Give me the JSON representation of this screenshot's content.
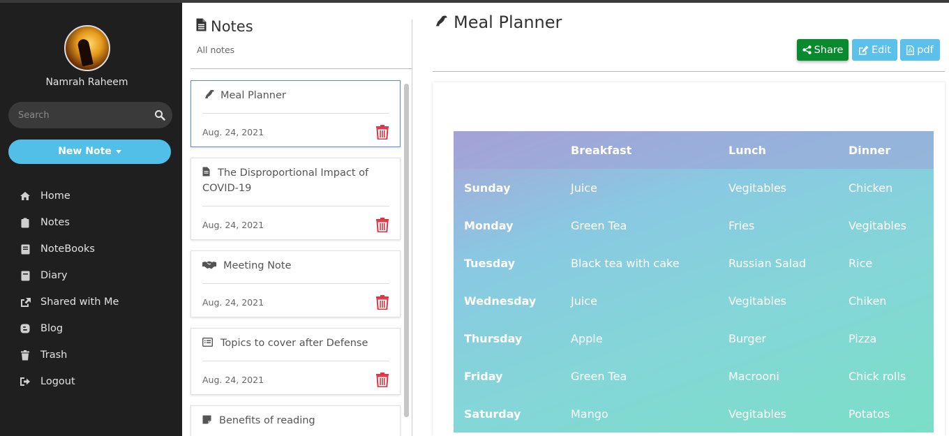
{
  "sidebar": {
    "username": "Namrah Raheem",
    "search_placeholder": "Search",
    "new_note_label": "New Note",
    "nav": [
      {
        "label": "Home",
        "icon": "home-icon"
      },
      {
        "label": "Notes",
        "icon": "clipboard-icon"
      },
      {
        "label": "NoteBooks",
        "icon": "book-icon"
      },
      {
        "label": "Diary",
        "icon": "diary-icon"
      },
      {
        "label": "Shared with Me",
        "icon": "share-square-icon"
      },
      {
        "label": "Blog",
        "icon": "blogger-icon"
      },
      {
        "label": "Trash",
        "icon": "trash-icon"
      },
      {
        "label": "Logout",
        "icon": "logout-icon"
      }
    ]
  },
  "notes": {
    "title": "Notes",
    "subtitle": "All notes",
    "items": [
      {
        "title": "Meal Planner",
        "date": "Aug. 24, 2021",
        "icon": "dinosaur-icon",
        "active": true
      },
      {
        "title": "The Disproportional Impact of COVID-19",
        "date": "Aug. 24, 2021",
        "icon": "file-icon"
      },
      {
        "title": "Meeting Note",
        "date": "Aug. 24, 2021",
        "icon": "handshake-icon"
      },
      {
        "title": "Topics to cover after Defense",
        "date": "Aug. 24, 2021",
        "icon": "list-alt-icon"
      },
      {
        "title": "Benefits of reading",
        "date": "",
        "icon": "sticky-note-icon"
      }
    ]
  },
  "content": {
    "title": "Meal Planner",
    "buttons": {
      "share": "Share",
      "edit": "Edit",
      "pdf": "pdf"
    },
    "table": {
      "headers": [
        "",
        "Breakfast",
        "Lunch",
        "Dinner"
      ],
      "rows": [
        [
          "Sunday",
          "Juice",
          "Vegitables",
          "Chicken"
        ],
        [
          "Monday",
          "Green Tea",
          "Fries",
          "Vegitables"
        ],
        [
          "Tuesday",
          "Black tea with cake",
          "Russian Salad",
          "Rice"
        ],
        [
          "Wednesday",
          "Juice",
          "Vegitables",
          "Chiken"
        ],
        [
          "Thursday",
          "Apple",
          "Burger",
          "Pizza"
        ],
        [
          "Friday",
          "Green Tea",
          "Macrooni",
          "Chick rolls"
        ],
        [
          "Saturday",
          "Mango",
          "Vegitables",
          "Potatos"
        ]
      ]
    }
  },
  "colors": {
    "sidebar_bg": "#1f1f1f",
    "accent": "#52bfe9",
    "share_green": "#098a2f",
    "delete_red": "#dc3545"
  }
}
